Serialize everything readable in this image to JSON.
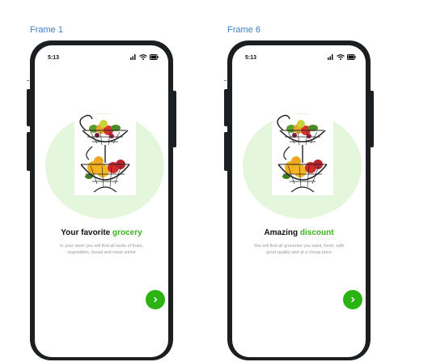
{
  "frames": [
    {
      "label": "Frame 1",
      "status_time": "5:13",
      "title_plain": "Your favorite ",
      "title_accent": "grocery",
      "description": "In your store you will find all kinds of fruits, vegetables, bread and meat online",
      "next_icon": "chevron-right-icon"
    },
    {
      "label": "Frame 6",
      "status_time": "5:13",
      "title_plain": "Amazing ",
      "title_accent": "discount",
      "description": "You will find all groceries you want, fresh, with good quality and at a cheap price",
      "next_icon": "chevron-right-icon"
    }
  ],
  "colors": {
    "accent": "#39b41e",
    "button": "#2ab312",
    "circle": "#e4f6dc",
    "phone": "#1c1f22",
    "frame_label": "#3d7fc8"
  }
}
